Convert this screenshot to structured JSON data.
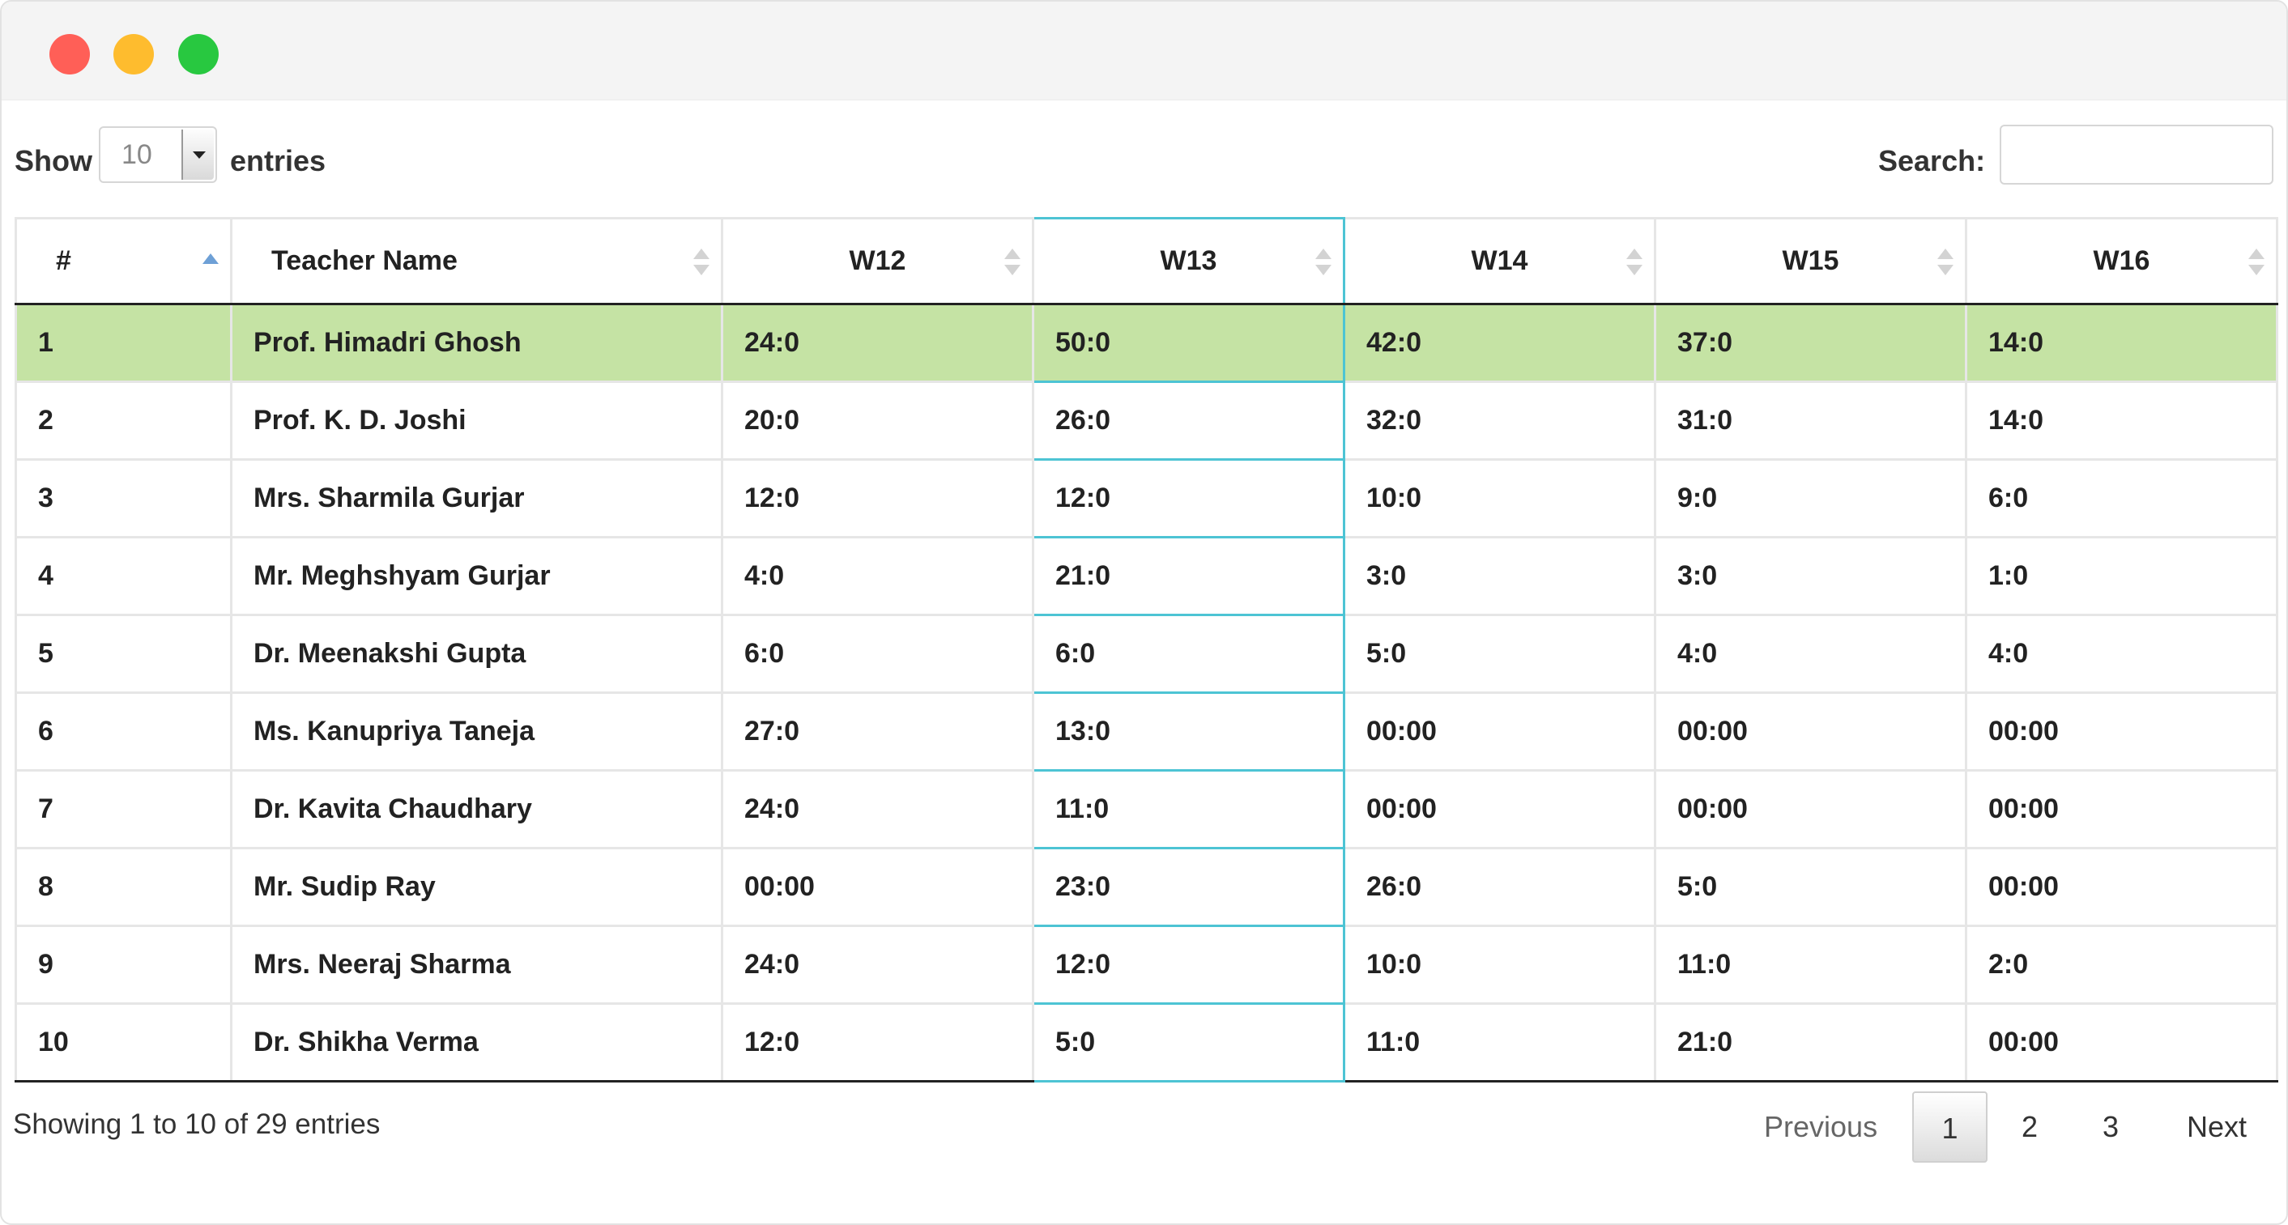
{
  "window": {
    "controls": [
      "close",
      "minimize",
      "maximize"
    ]
  },
  "length_menu": {
    "show_label": "Show",
    "selected": "10",
    "entries_label": "entries"
  },
  "search": {
    "label": "Search:",
    "value": ""
  },
  "table": {
    "columns": [
      "#",
      "Teacher Name",
      "W12",
      "W13",
      "W14",
      "W15",
      "W16"
    ],
    "sorted_column": "#",
    "sort_direction": "ascending",
    "highlighted_column": "W13",
    "highlighted_row": "1",
    "highlight_color": "#c5e3a4",
    "column_border_color": "#4dc4d4",
    "rows": [
      [
        "1",
        "Prof. Himadri Ghosh",
        "24:0",
        "50:0",
        "42:0",
        "37:0",
        "14:0"
      ],
      [
        "2",
        "Prof. K. D. Joshi",
        "20:0",
        "26:0",
        "32:0",
        "31:0",
        "14:0"
      ],
      [
        "3",
        "Mrs. Sharmila Gurjar",
        "12:0",
        "12:0",
        "10:0",
        "9:0",
        "6:0"
      ],
      [
        "4",
        "Mr. Meghshyam Gurjar",
        "4:0",
        "21:0",
        "3:0",
        "3:0",
        "1:0"
      ],
      [
        "5",
        "Dr. Meenakshi Gupta",
        "6:0",
        "6:0",
        "5:0",
        "4:0",
        "4:0"
      ],
      [
        "6",
        "Ms. Kanupriya Taneja",
        "27:0",
        "13:0",
        "00:00",
        "00:00",
        "00:00"
      ],
      [
        "7",
        "Dr. Kavita Chaudhary",
        "24:0",
        "11:0",
        "00:00",
        "00:00",
        "00:00"
      ],
      [
        "8",
        "Mr. Sudip Ray",
        "00:00",
        "23:0",
        "26:0",
        "5:0",
        "00:00"
      ],
      [
        "9",
        "Mrs. Neeraj Sharma",
        "24:0",
        "12:0",
        "10:0",
        "11:0",
        "2:0"
      ],
      [
        "10",
        "Dr. Shikha Verma",
        "12:0",
        "5:0",
        "11:0",
        "21:0",
        "00:00"
      ]
    ]
  },
  "info": "Showing 1 to 10 of 29 entries",
  "pagination": {
    "previous": "Previous",
    "pages": [
      "1",
      "2",
      "3"
    ],
    "current": "1",
    "next": "Next"
  }
}
